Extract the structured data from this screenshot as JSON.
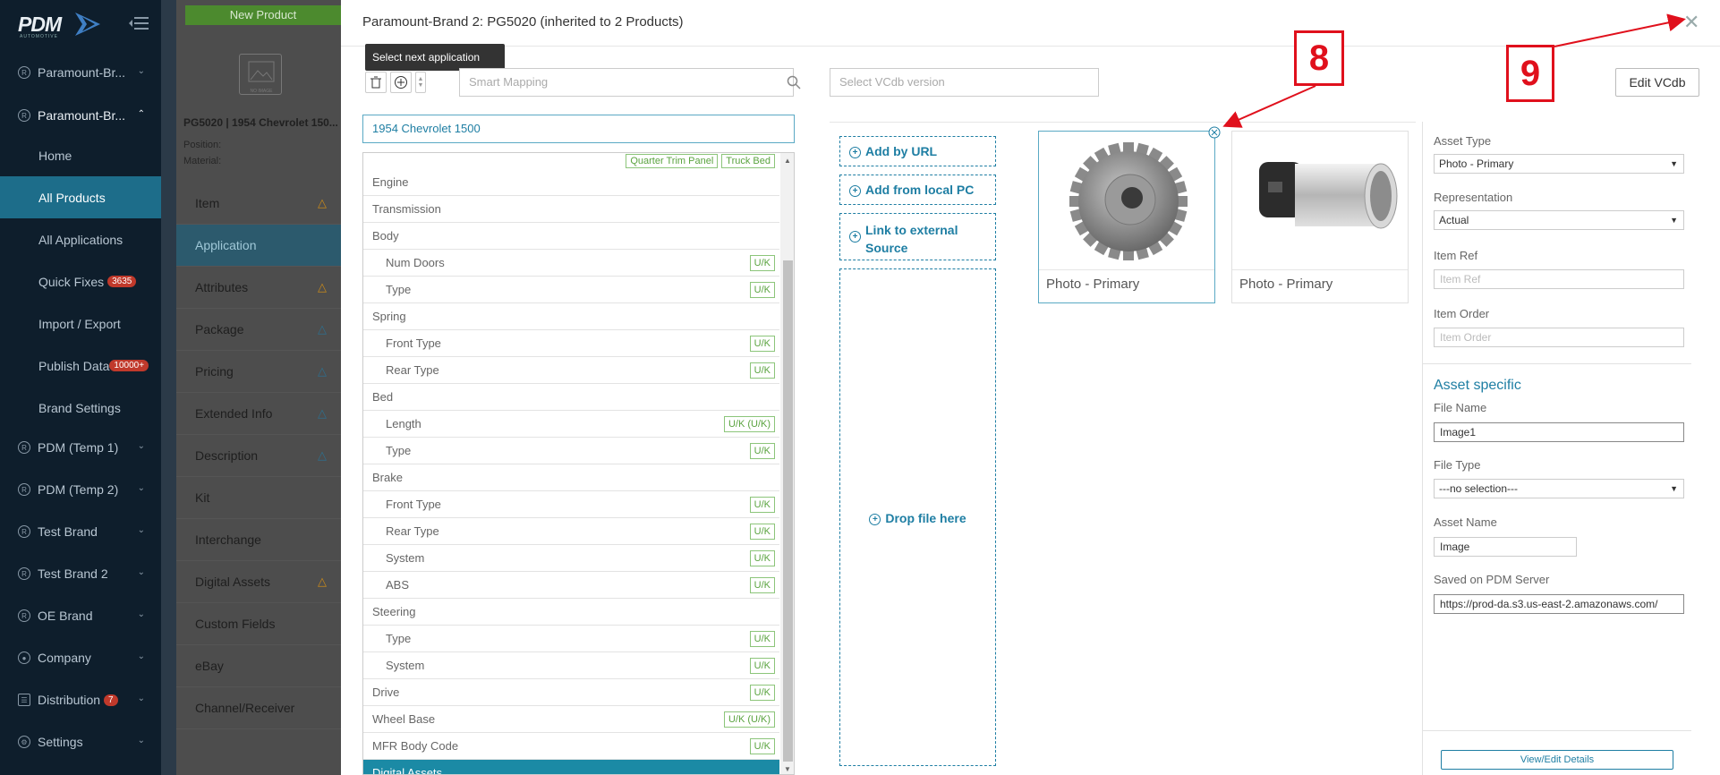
{
  "sidebar": {
    "logo_text": "PDM",
    "logo_sub": "AUTOMOTIVE",
    "brands": [
      {
        "label": "Paramount-Br...",
        "expanded": false
      },
      {
        "label": "Paramount-Br...",
        "expanded": true
      }
    ],
    "sub_items": [
      {
        "label": "Home"
      },
      {
        "label": "All Products",
        "active": true
      },
      {
        "label": "All Applications"
      },
      {
        "label": "Quick Fixes",
        "badge": "3635"
      },
      {
        "label": "Import / Export"
      },
      {
        "label": "Publish Data",
        "badge": "10000+"
      },
      {
        "label": "Brand Settings"
      }
    ],
    "bottom_items": [
      {
        "label": "PDM (Temp 1)"
      },
      {
        "label": "PDM (Temp 2)"
      },
      {
        "label": "Test Brand"
      },
      {
        "label": "Test Brand 2"
      },
      {
        "label": "OE Brand"
      },
      {
        "label": "Company"
      },
      {
        "label": "Distribution",
        "badge": "7"
      },
      {
        "label": "Settings"
      }
    ]
  },
  "product_panel": {
    "new_product": "New Product",
    "thumb_text": "NO IMAGE",
    "title": "PG5020 | 1954 Chevrolet 150...",
    "position_label": "Position:",
    "material_label": "Material:",
    "items": [
      {
        "label": "Item",
        "warn": "triangle-orange"
      },
      {
        "label": "Application",
        "active": true
      },
      {
        "label": "Attributes",
        "warn": "triangle-orange"
      },
      {
        "label": "Package",
        "warn": "triangle-blue"
      },
      {
        "label": "Pricing",
        "warn": "triangle-blue"
      },
      {
        "label": "Extended Info",
        "warn": "triangle-blue"
      },
      {
        "label": "Description",
        "warn": "triangle-blue"
      },
      {
        "label": "Kit"
      },
      {
        "label": "Interchange"
      },
      {
        "label": "Digital Assets",
        "warn": "triangle-orange"
      },
      {
        "label": "Custom Fields"
      },
      {
        "label": "eBay"
      },
      {
        "label": "Channel/Receiver"
      }
    ]
  },
  "modal": {
    "title": "Paramount-Brand 2: PG5020 (inherited to 2 Products)",
    "tooltip": "Select next application",
    "smart_mapping_placeholder": "Smart Mapping",
    "vcdb_placeholder": "Select VCdb version",
    "edit_vcdb": "Edit VCdb",
    "application_value": "1954 Chevrolet 1500"
  },
  "tree": {
    "top_tags": [
      "Quarter Trim Panel",
      "Truck Bed"
    ],
    "rows": [
      {
        "label": "Engine",
        "sub": false,
        "tag": ""
      },
      {
        "label": "Transmission",
        "sub": false,
        "tag": ""
      },
      {
        "label": "Body",
        "sub": false,
        "tag": ""
      },
      {
        "label": "Num Doors",
        "sub": true,
        "tag": "U/K"
      },
      {
        "label": "Type",
        "sub": true,
        "tag": "U/K"
      },
      {
        "label": "Spring",
        "sub": false,
        "tag": ""
      },
      {
        "label": "Front Type",
        "sub": true,
        "tag": "U/K"
      },
      {
        "label": "Rear Type",
        "sub": true,
        "tag": "U/K"
      },
      {
        "label": "Bed",
        "sub": false,
        "tag": ""
      },
      {
        "label": "Length",
        "sub": true,
        "tag": "U/K (U/K)"
      },
      {
        "label": "Type",
        "sub": true,
        "tag": "U/K"
      },
      {
        "label": "Brake",
        "sub": false,
        "tag": ""
      },
      {
        "label": "Front Type",
        "sub": true,
        "tag": "U/K"
      },
      {
        "label": "Rear Type",
        "sub": true,
        "tag": "U/K"
      },
      {
        "label": "System",
        "sub": true,
        "tag": "U/K"
      },
      {
        "label": "ABS",
        "sub": true,
        "tag": "U/K"
      },
      {
        "label": "Steering",
        "sub": false,
        "tag": ""
      },
      {
        "label": "Type",
        "sub": true,
        "tag": "U/K"
      },
      {
        "label": "System",
        "sub": true,
        "tag": "U/K"
      },
      {
        "label": "Drive",
        "sub": false,
        "tag": "U/K"
      },
      {
        "label": "Wheel Base",
        "sub": false,
        "tag": "U/K (U/K)"
      },
      {
        "label": "MFR Body Code",
        "sub": false,
        "tag": "U/K"
      },
      {
        "label": "Digital Assets",
        "sub": false,
        "tag": "",
        "active": true
      }
    ]
  },
  "upload": {
    "add_url": "Add by URL",
    "add_local": "Add from local PC",
    "link_external_1": "Link to external",
    "link_external_2": "Source",
    "drop": "Drop file here"
  },
  "assets": [
    {
      "label": "Photo - Primary",
      "icon": "gear-image",
      "selected": true
    },
    {
      "label": "Photo - Primary",
      "icon": "cylinder-part-image",
      "selected": false
    }
  ],
  "details": {
    "asset_type_label": "Asset Type",
    "asset_type_value": "Photo - Primary",
    "representation_label": "Representation",
    "representation_value": "Actual",
    "item_ref_label": "Item Ref",
    "item_ref_placeholder": "Item Ref",
    "item_order_label": "Item Order",
    "item_order_placeholder": "Item Order",
    "asset_specific": "Asset specific",
    "file_name_label": "File Name",
    "file_name_value": "Image1",
    "file_type_label": "File Type",
    "file_type_value": "---no selection---",
    "asset_name_label": "Asset Name",
    "asset_name_value": "Image",
    "saved_label": "Saved on PDM Server",
    "saved_value": "https://prod-da.s3.us-east-2.amazonaws.com/",
    "view_edit": "View/Edit Details"
  },
  "annotations": {
    "a8": "8",
    "a9": "9"
  },
  "colors": {
    "accent": "#1e7ea3",
    "sidebar": "#0e1e2c",
    "annotation": "#e0101c",
    "tag_green": "#5aa33f"
  }
}
